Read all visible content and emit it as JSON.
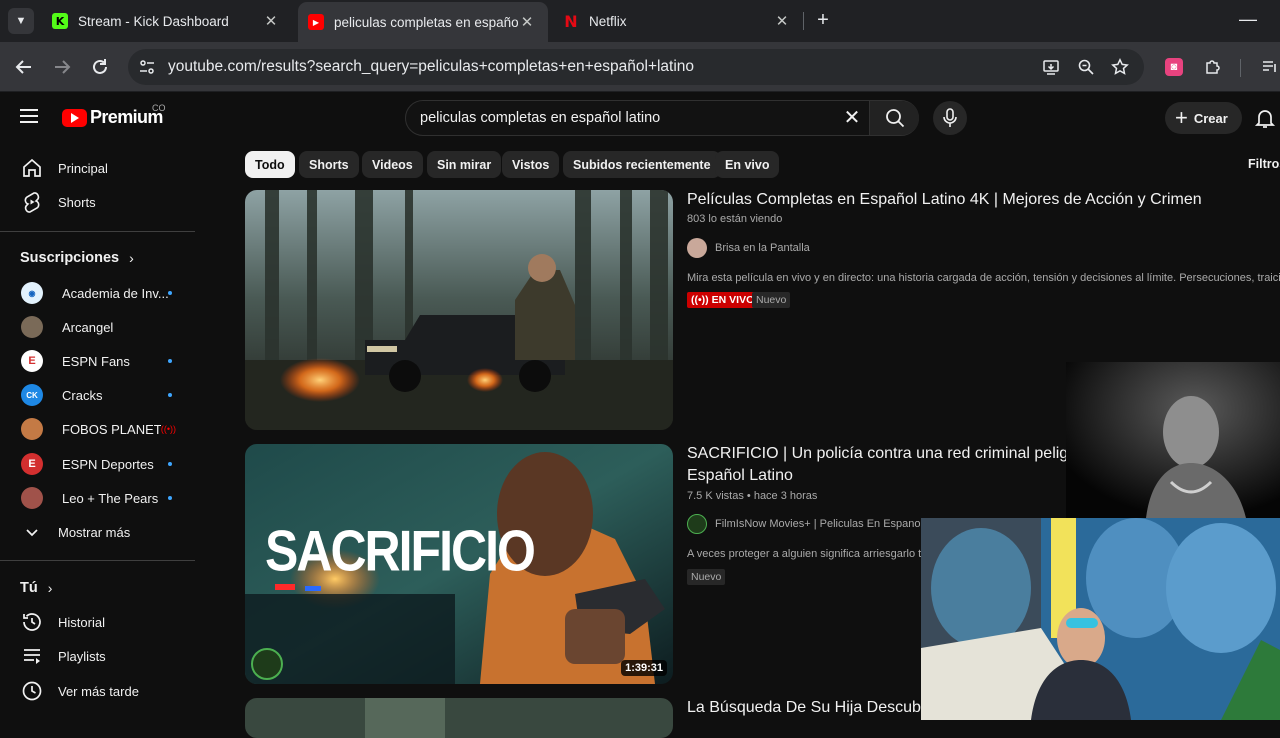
{
  "browser": {
    "tabs": [
      {
        "title": "Stream - Kick Dashboard",
        "favicon": "kick-icon",
        "active": false
      },
      {
        "title": "peliculas completas en español",
        "favicon": "youtube-icon",
        "active": true
      },
      {
        "title": "Netflix",
        "favicon": "netflix-icon",
        "active": false
      }
    ],
    "url": "youtube.com/results?search_query=peliculas+completas+en+español+latino"
  },
  "header": {
    "logo_text": "Premium",
    "country_code": "CO",
    "search_value": "peliculas completas en español latino",
    "create_label": "Crear"
  },
  "sidebar": {
    "main_items": [
      {
        "label": "Principal",
        "icon": "home-icon"
      },
      {
        "label": "Shorts",
        "icon": "shorts-icon"
      }
    ],
    "subscriptions_heading": "Suscripciones",
    "subscriptions": [
      {
        "label": "Academia de Inv...",
        "indicator": "dot",
        "color": "#1565c0"
      },
      {
        "label": "Arcangel",
        "indicator": "none",
        "color": "#7a6a58"
      },
      {
        "label": "ESPN Fans",
        "indicator": "dot",
        "color": "#d32f2f"
      },
      {
        "label": "Cracks",
        "indicator": "dot",
        "color": "#1e88e5"
      },
      {
        "label": "FOBOS PLANET",
        "indicator": "live",
        "color": "#c47a45"
      },
      {
        "label": "ESPN Deportes",
        "indicator": "dot",
        "color": "#d32f2f"
      },
      {
        "label": "Leo + The Pears",
        "indicator": "dot",
        "color": "#a0524a"
      }
    ],
    "show_more": "Mostrar más",
    "you_heading": "Tú",
    "you_items": [
      {
        "label": "Historial",
        "icon": "history-icon"
      },
      {
        "label": "Playlists",
        "icon": "playlists-icon"
      },
      {
        "label": "Ver más tarde",
        "icon": "watch-later-icon"
      }
    ]
  },
  "chips": [
    "Todo",
    "Shorts",
    "Videos",
    "Sin mirar",
    "Vistos",
    "Subidos recientemente",
    "En vivo"
  ],
  "filters_label": "Filtros",
  "results": [
    {
      "title": "Películas Completas en Español Latino 4K | Mejores de Acción y Crimen",
      "meta": "803 lo están viendo",
      "channel": "Brisa en la Pantalla",
      "description": "Mira esta película en vivo y en directo: una historia cargada de acción, tensión y decisiones al límite. Persecuciones, traiciones y ...",
      "live_badge": "EN VIVO",
      "new_badge": "Nuevo"
    },
    {
      "title_line1": "SACRIFICIO | Un policía contra una red criminal peligros",
      "title_line2": "Español Latino",
      "meta": "7.5 K vistas • hace 3 horas",
      "channel": "FilmIsNow Movies+ | Peliculas En Espanol La",
      "description": "A veces proteger a alguien significa arriesgarlo todo",
      "new_badge": "Nuevo",
      "duration": "1:39:31",
      "thumb_text": "SACRIFICIO"
    },
    {
      "title": "La Búsqueda De Su Hija Descubre"
    }
  ]
}
